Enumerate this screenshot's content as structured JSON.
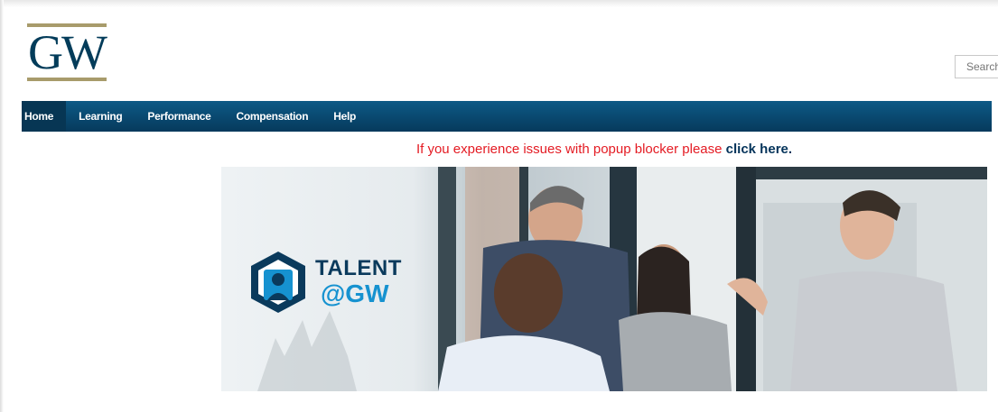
{
  "header": {
    "logo_text": "GW",
    "search_placeholder": "Search"
  },
  "nav": {
    "items": [
      {
        "label": "Home"
      },
      {
        "label": "Learning"
      },
      {
        "label": "Performance"
      },
      {
        "label": "Compensation"
      },
      {
        "label": "Help"
      }
    ],
    "active_index": 0
  },
  "notice": {
    "text": "If you experience issues with popup blocker please",
    "link_text": "click here."
  },
  "banner": {
    "logo_line1": "TALENT",
    "logo_line2": "@GW"
  },
  "colors": {
    "brand_navy": "#033c5a",
    "brand_gold": "#a89b6b",
    "nav_bar": "#0a4b73",
    "notice_red": "#e41b23",
    "accent_blue": "#1692d0"
  }
}
